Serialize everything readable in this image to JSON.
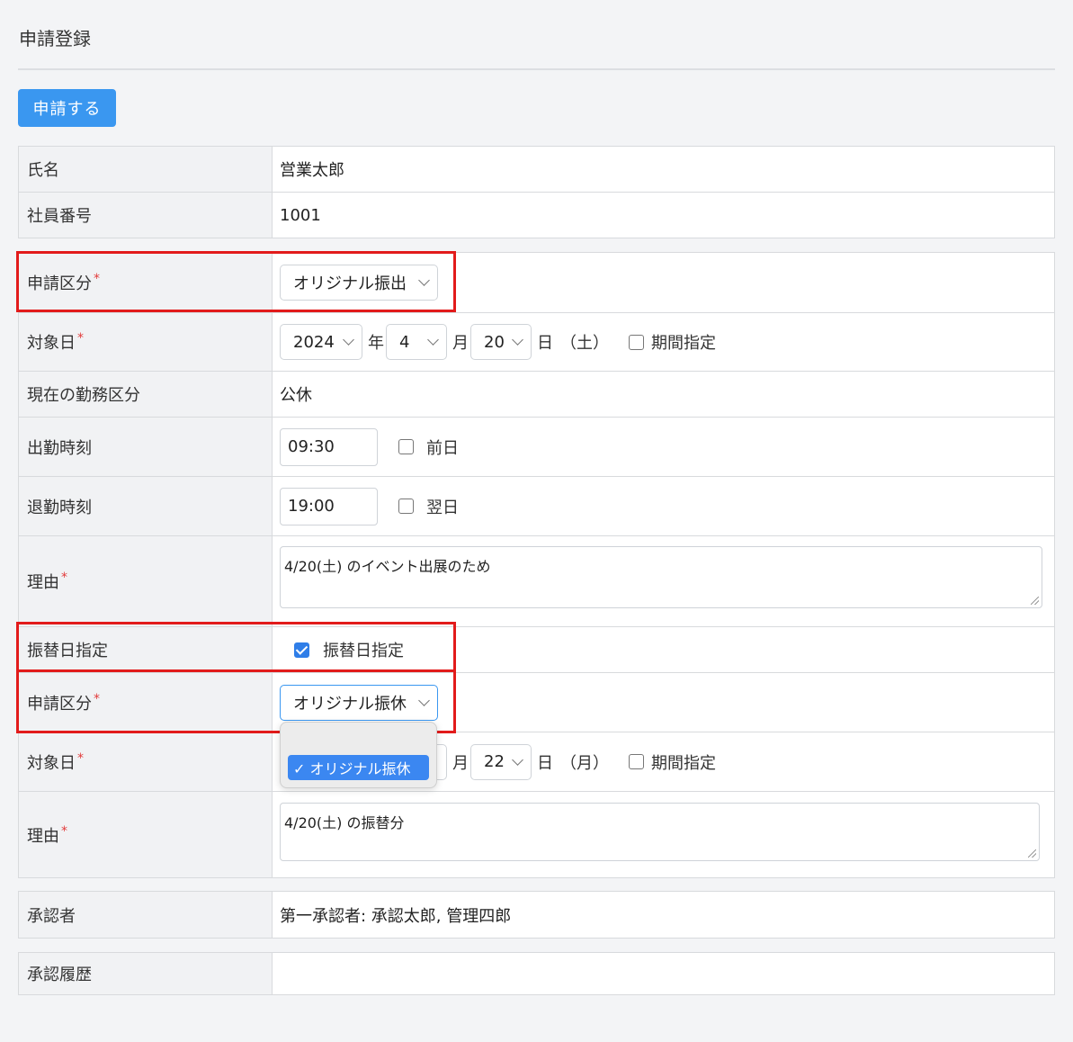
{
  "page": {
    "title": "申請登録"
  },
  "toolbar": {
    "submit_label": "申請する"
  },
  "basic": {
    "name_label": "氏名",
    "name_value": "営業太郎",
    "empno_label": "社員番号",
    "empno_value": "1001"
  },
  "app": {
    "category_label": "申請区分",
    "required_mark": "*",
    "category_value": "オリジナル振出",
    "date_label": "対象日",
    "year": "2024",
    "year_unit": "年",
    "month": "4",
    "month_unit": "月",
    "day": "20",
    "day_unit": "日",
    "weekday": "（土）",
    "period_label": "期間指定",
    "current_shift_label": "現在の勤務区分",
    "current_shift_value": "公休",
    "start_label": "出勤時刻",
    "start_value": "09:30",
    "prev_day_label": "前日",
    "end_label": "退勤時刻",
    "end_value": "19:00",
    "next_day_label": "翌日",
    "reason_label": "理由",
    "reason_value": "4/20(土) のイベント出展のため"
  },
  "substitute": {
    "designate_label": "振替日指定",
    "designate_checkbox_label": "振替日指定",
    "designate_checked": true,
    "category_label": "申請区分",
    "category_value": "オリジナル振休",
    "date_label": "対象日",
    "month_unit": "月",
    "day": "22",
    "day_unit": "日",
    "weekday": "（月）",
    "period_label": "期間指定",
    "reason_label": "理由",
    "reason_value": "4/20(土) の振替分",
    "dropdown_option": "✓ オリジナル振休"
  },
  "approval": {
    "approver_label": "承認者",
    "approver_value": "第一承認者: 承認太郎, 管理四郎",
    "history_label": "承認履歴",
    "history_value": ""
  },
  "colors": {
    "accent": "#3a97f0",
    "highlight": "#e21b1b",
    "required": "#e23b3b"
  }
}
